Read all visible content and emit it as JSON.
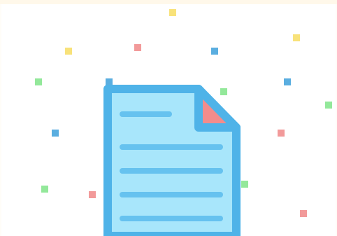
{
  "illustration": {
    "subject": "document-icon",
    "colors": {
      "page_fill": "#a8e6fb",
      "page_stroke": "#4fb3e8",
      "text_lines": "#66c2ef",
      "corner_fold": "#f38c8c",
      "confetti_yellow": "#f8e27a",
      "confetti_red": "#f29a9a",
      "confetti_blue": "#5aaee0",
      "confetti_green": "#93e89a"
    },
    "confetti_count": 16
  }
}
